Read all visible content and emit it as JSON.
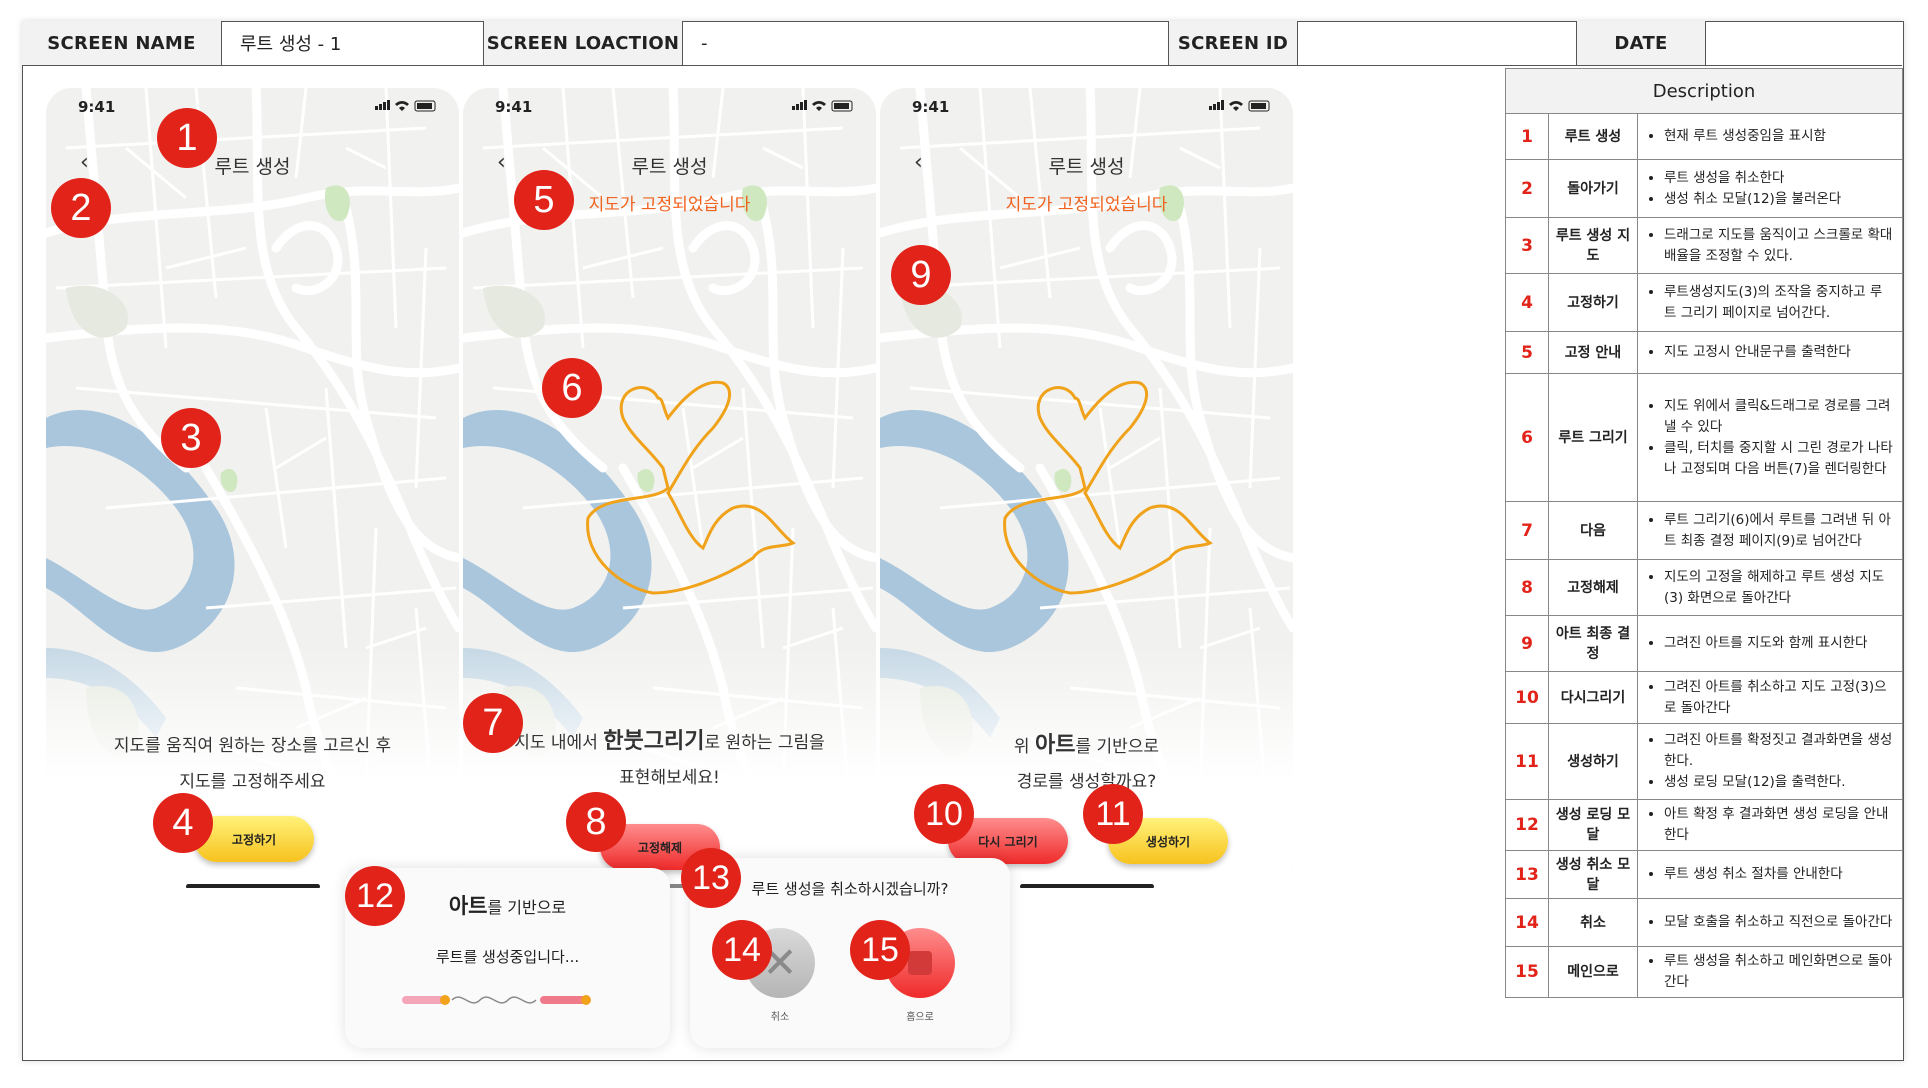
{
  "header": {
    "screen_name_label": "SCREEN NAME",
    "screen_name_value": "루트 생성 - 1",
    "screen_location_label": "SCREEN LOACTION",
    "screen_location_value": "-",
    "screen_id_label": "SCREEN ID",
    "screen_id_value": "",
    "date_label": "DATE",
    "date_value": ""
  },
  "phone1": {
    "time": "9:41",
    "title": "루트 생성",
    "guide_line1": "지도를 움직여 원하는 장소를 고르신 후",
    "guide_line2": "지도를 고정해주세요",
    "fix_button": "고정하기"
  },
  "phone2": {
    "time": "9:41",
    "title": "루트 생성",
    "fixed_notice": "지도가 고정되었습니다",
    "guide_pre": "지도 내에서 ",
    "guide_bold": "한붓그리기",
    "guide_post": "로 원하는 그림을",
    "guide_line2": "표현해보세요!",
    "unfix_button": "고정해제"
  },
  "phone3": {
    "time": "9:41",
    "title": "루트 생성",
    "fixed_notice": "지도가 고정되었습니다",
    "guide_pre": "위 ",
    "guide_bold": "아트",
    "guide_post": "를 기반으로",
    "guide_line2": "경로를 생성할까요?",
    "redraw_button": "다시 그리기",
    "create_button": "생성하기"
  },
  "loading_modal": {
    "line1_bold": "아트",
    "line1_rest": "를 기반으로",
    "line2": "루트를 생성중입니다..."
  },
  "cancel_modal": {
    "question": "루트 생성을 취소하시겠습니까?",
    "cancel_label": "취소",
    "home_label": "홈으로"
  },
  "markers": [
    "1",
    "2",
    "3",
    "4",
    "5",
    "6",
    "7",
    "8",
    "9",
    "10",
    "11",
    "12",
    "13",
    "14",
    "15"
  ],
  "description": {
    "heading": "Description",
    "rows": [
      {
        "num": "1",
        "title": "루트 생성",
        "items": [
          "현재 루트 생성중임을 표시함"
        ]
      },
      {
        "num": "2",
        "title": "돌아가기",
        "items": [
          "루트 생성을 취소한다",
          "생성 취소 모달(12)을 불러온다"
        ]
      },
      {
        "num": "3",
        "title": "루트 생성 지도",
        "items": [
          "드래그로 지도를 움직이고 스크롤로 확대 배율을 조정할 수 있다."
        ]
      },
      {
        "num": "4",
        "title": "고정하기",
        "items": [
          "루트생성지도(3)의 조작을 중지하고 루트 그리기 페이지로 넘어간다."
        ]
      },
      {
        "num": "5",
        "title": "고정 안내",
        "items": [
          "지도 고정시 안내문구를 출력한다"
        ]
      },
      {
        "num": "6",
        "title": "루트 그리기",
        "items": [
          "지도 위에서 클릭&드래그로 경로를 그려낼 수 있다",
          "클릭, 터치를 중지할 시 그린 경로가 나타나 고정되며 다음 버튼(7)을 렌더링한다"
        ]
      },
      {
        "num": "7",
        "title": "다음",
        "items": [
          "루트 그리기(6)에서 루트를 그려낸 뒤 아트 최종 결정 페이지(9)로 넘어간다"
        ]
      },
      {
        "num": "8",
        "title": "고정해제",
        "items": [
          "지도의 고정을 해제하고 루트 생성 지도(3) 화면으로 돌아간다"
        ]
      },
      {
        "num": "9",
        "title": "아트 최종 결정",
        "items": [
          "그려진 아트를 지도와 함께 표시한다"
        ]
      },
      {
        "num": "10",
        "title": "다시그리기",
        "items": [
          "그려진 아트를 취소하고 지도 고정(3)으로 돌아간다"
        ]
      },
      {
        "num": "11",
        "title": "생성하기",
        "items": [
          "그려진 아트를 확정짓고 결과화면을 생성한다.",
          "생성 로딩 모달(12)을 출력한다."
        ]
      },
      {
        "num": "12",
        "title": "생성 로딩 모달",
        "items": [
          "아트 확정 후 결과화면 생성 로딩을 안내한다"
        ]
      },
      {
        "num": "13",
        "title": "생성 취소 모달",
        "items": [
          "루트 생성 취소 절차를 안내한다"
        ]
      },
      {
        "num": "14",
        "title": "취소",
        "items": [
          "모달 호출을 취소하고 직전으로 돌아간다"
        ]
      },
      {
        "num": "15",
        "title": "메인으로",
        "items": [
          "루트 생성을 취소하고 메인화면으로 돌아간다"
        ]
      }
    ]
  },
  "colors": {
    "marker": "#e2231a",
    "route": "#f0a21a",
    "notice": "#f0631f",
    "river": "#a9c6dd",
    "park": "#cfe8c0"
  }
}
